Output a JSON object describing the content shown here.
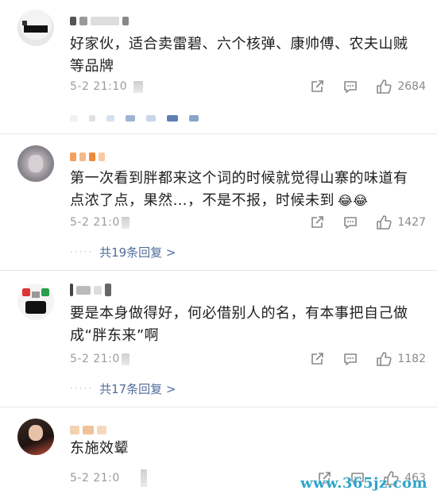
{
  "comments": [
    {
      "text_line1": "好家伙，适合卖雷碧、六个核弹、康帅傅、农夫山贼",
      "text_line2": "等品牌",
      "time": "5-2 21:10",
      "likes": "2684"
    },
    {
      "text_line1": "第一次看到胖都来这个词的时候就觉得山寨的味道有",
      "text_line2": "点浓了点，果然…，不是不报，时候未到",
      "emoji": "😂😂",
      "time": "5-2 21:0",
      "likes": "1427",
      "replies": "共19条回复 >"
    },
    {
      "text_line1": "要是本身做得好，何必借别人的名，有本事把自己做",
      "text_line2": "成“胖东来”啊",
      "time": "5-2 21:0",
      "likes": "1182",
      "replies": "共17条回复 >"
    },
    {
      "text_line1": "东施效颦",
      "time": "5-2 21:0",
      "likes": "463"
    }
  ],
  "icons": {
    "repost": "share-icon",
    "comment": "comment-icon",
    "like": "thumbs-up-icon"
  },
  "watermark": "www.365jz.com",
  "colors": {
    "link": "#506c9b",
    "meta": "#9b9b9b",
    "watermark": "#2fa3c8"
  }
}
